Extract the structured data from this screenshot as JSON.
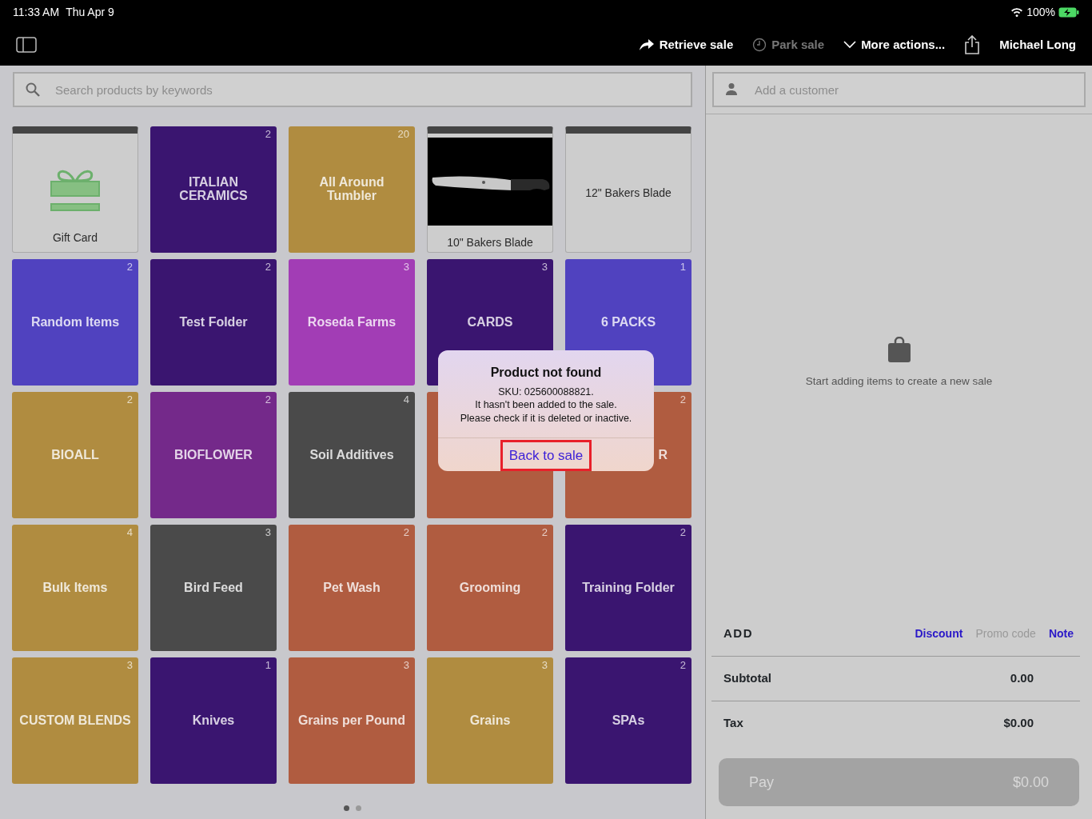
{
  "status_bar": {
    "time": "11:33 AM",
    "date": "Thu Apr 9",
    "battery": "100%"
  },
  "toolbar": {
    "actions": [
      {
        "kind": "retrieve",
        "label": "Retrieve sale",
        "disabled": false
      },
      {
        "kind": "park",
        "label": "Park sale",
        "disabled": true
      },
      {
        "kind": "more",
        "label": "More actions...",
        "disabled": false
      }
    ],
    "user": "Michael Long"
  },
  "search": {
    "placeholder": "Search products by keywords"
  },
  "tiles": [
    {
      "kind": "gift",
      "label": "Gift Card"
    },
    {
      "kind": "folder",
      "label": "ITALIAN CERAMICS",
      "count": "2",
      "color": "#3a1570"
    },
    {
      "kind": "folder",
      "label": "All Around Tumbler",
      "count": "20",
      "color": "#b08c40"
    },
    {
      "label": "10\" Bakers Blade"
    },
    {
      "kind": "product",
      "label": "12\" Bakers Blade"
    },
    {
      "kind": "folder",
      "label": "Random Items",
      "count": "2",
      "color": "#5042bf"
    },
    {
      "kind": "folder",
      "label": "Test Folder",
      "count": "2",
      "color": "#3a1570"
    },
    {
      "kind": "folder",
      "label": "Roseda Farms",
      "count": "3",
      "color": "#a23db5"
    },
    {
      "kind": "folder",
      "label": "CARDS",
      "count": "3",
      "color": "#3a1570"
    },
    {
      "kind": "folder",
      "label": "6 PACKS",
      "count": "1",
      "color": "#5042bf"
    },
    {
      "kind": "folder",
      "label": "BIOALL",
      "count": "2",
      "color": "#b08c40"
    },
    {
      "kind": "folder",
      "label": "BIOFLOWER",
      "count": "2",
      "color": "#74298a"
    },
    {
      "kind": "folder",
      "label": "Soil Additives",
      "count": "4",
      "color": "#4a4a4a"
    },
    {
      "kind": "covered",
      "color": "#b05c40"
    },
    {
      "kind": "partial",
      "label": "R",
      "count": "2",
      "color": "#b05c40"
    },
    {
      "kind": "folder",
      "label": "Bulk Items",
      "count": "4",
      "color": "#b08c40"
    },
    {
      "kind": "folder",
      "label": "Bird Feed",
      "count": "3",
      "color": "#4a4a4a"
    },
    {
      "kind": "folder",
      "label": "Pet Wash",
      "count": "2",
      "color": "#b05c40"
    },
    {
      "kind": "folder",
      "label": "Grooming",
      "count": "2",
      "color": "#b05c40"
    },
    {
      "kind": "folder",
      "label": "Training Folder",
      "count": "2",
      "color": "#3a1570"
    },
    {
      "kind": "folder",
      "label": "CUSTOM BLENDS",
      "count": "3",
      "color": "#b08c40"
    },
    {
      "kind": "folder",
      "label": "Knives",
      "count": "1",
      "color": "#3a1570"
    },
    {
      "kind": "folder",
      "label": "Grains per Pound",
      "count": "3",
      "color": "#b05c40"
    },
    {
      "kind": "folder",
      "label": "Grains",
      "count": "3",
      "color": "#b08c40"
    },
    {
      "kind": "folder",
      "label": "SPAs",
      "count": "2",
      "color": "#3a1570"
    }
  ],
  "pages": [
    {
      "selected": true
    },
    {
      "selected": false
    }
  ],
  "customer": {
    "placeholder": "Add a customer"
  },
  "empty_message": "Start adding items to create a new sale",
  "add": {
    "title": "ADD",
    "links": [
      {
        "label": "Discount",
        "disabled": false
      },
      {
        "label": "Promo code",
        "disabled": true
      },
      {
        "label": "Note",
        "disabled": false
      }
    ]
  },
  "totals": [
    {
      "label": "Subtotal",
      "value": "0.00"
    },
    {
      "label": "Tax",
      "value": "$0.00"
    }
  ],
  "pay": {
    "label": "Pay",
    "amount": "$0.00",
    "disabled": true
  },
  "dialog": {
    "title": "Product not found",
    "lines": [
      "SKU: 025600088821.",
      "It hasn't been added to the sale.",
      "Please check if it is deleted or inactive."
    ],
    "button": "Back to sale",
    "highlighted": true
  }
}
